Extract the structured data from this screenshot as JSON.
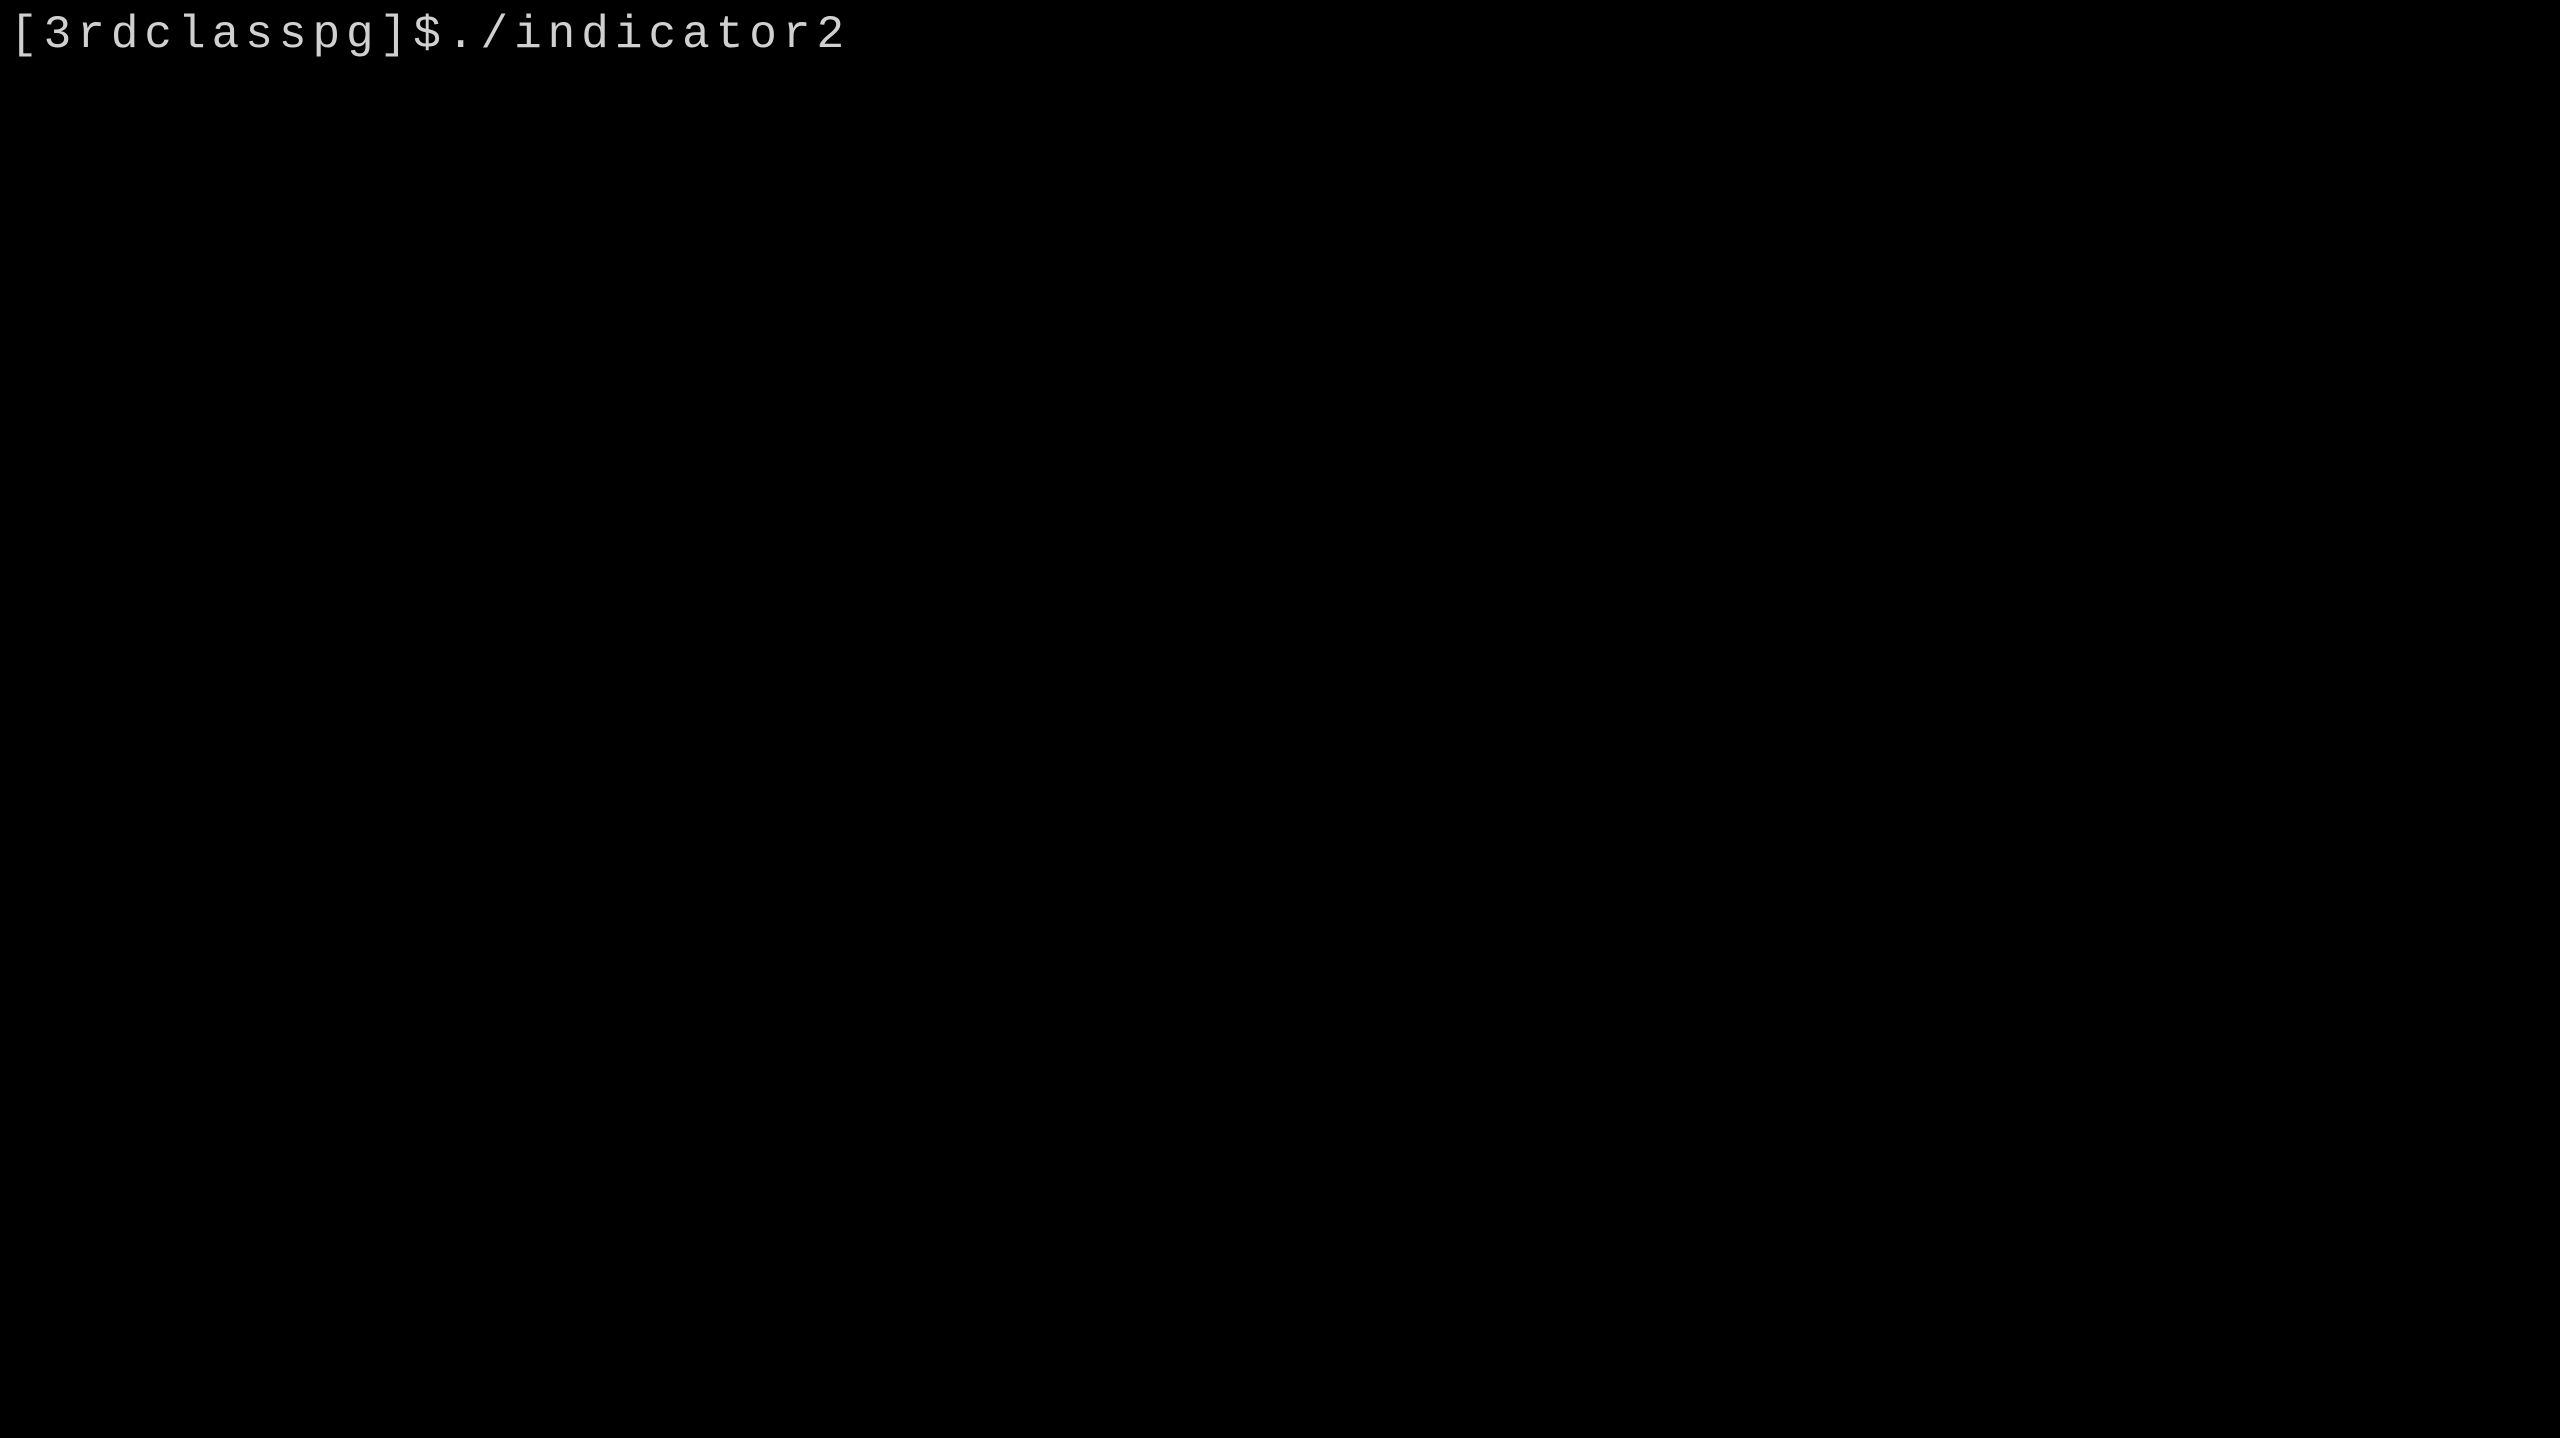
{
  "terminal": {
    "prompt": "[3rdclasspg]$",
    "command": "./indicator2"
  }
}
